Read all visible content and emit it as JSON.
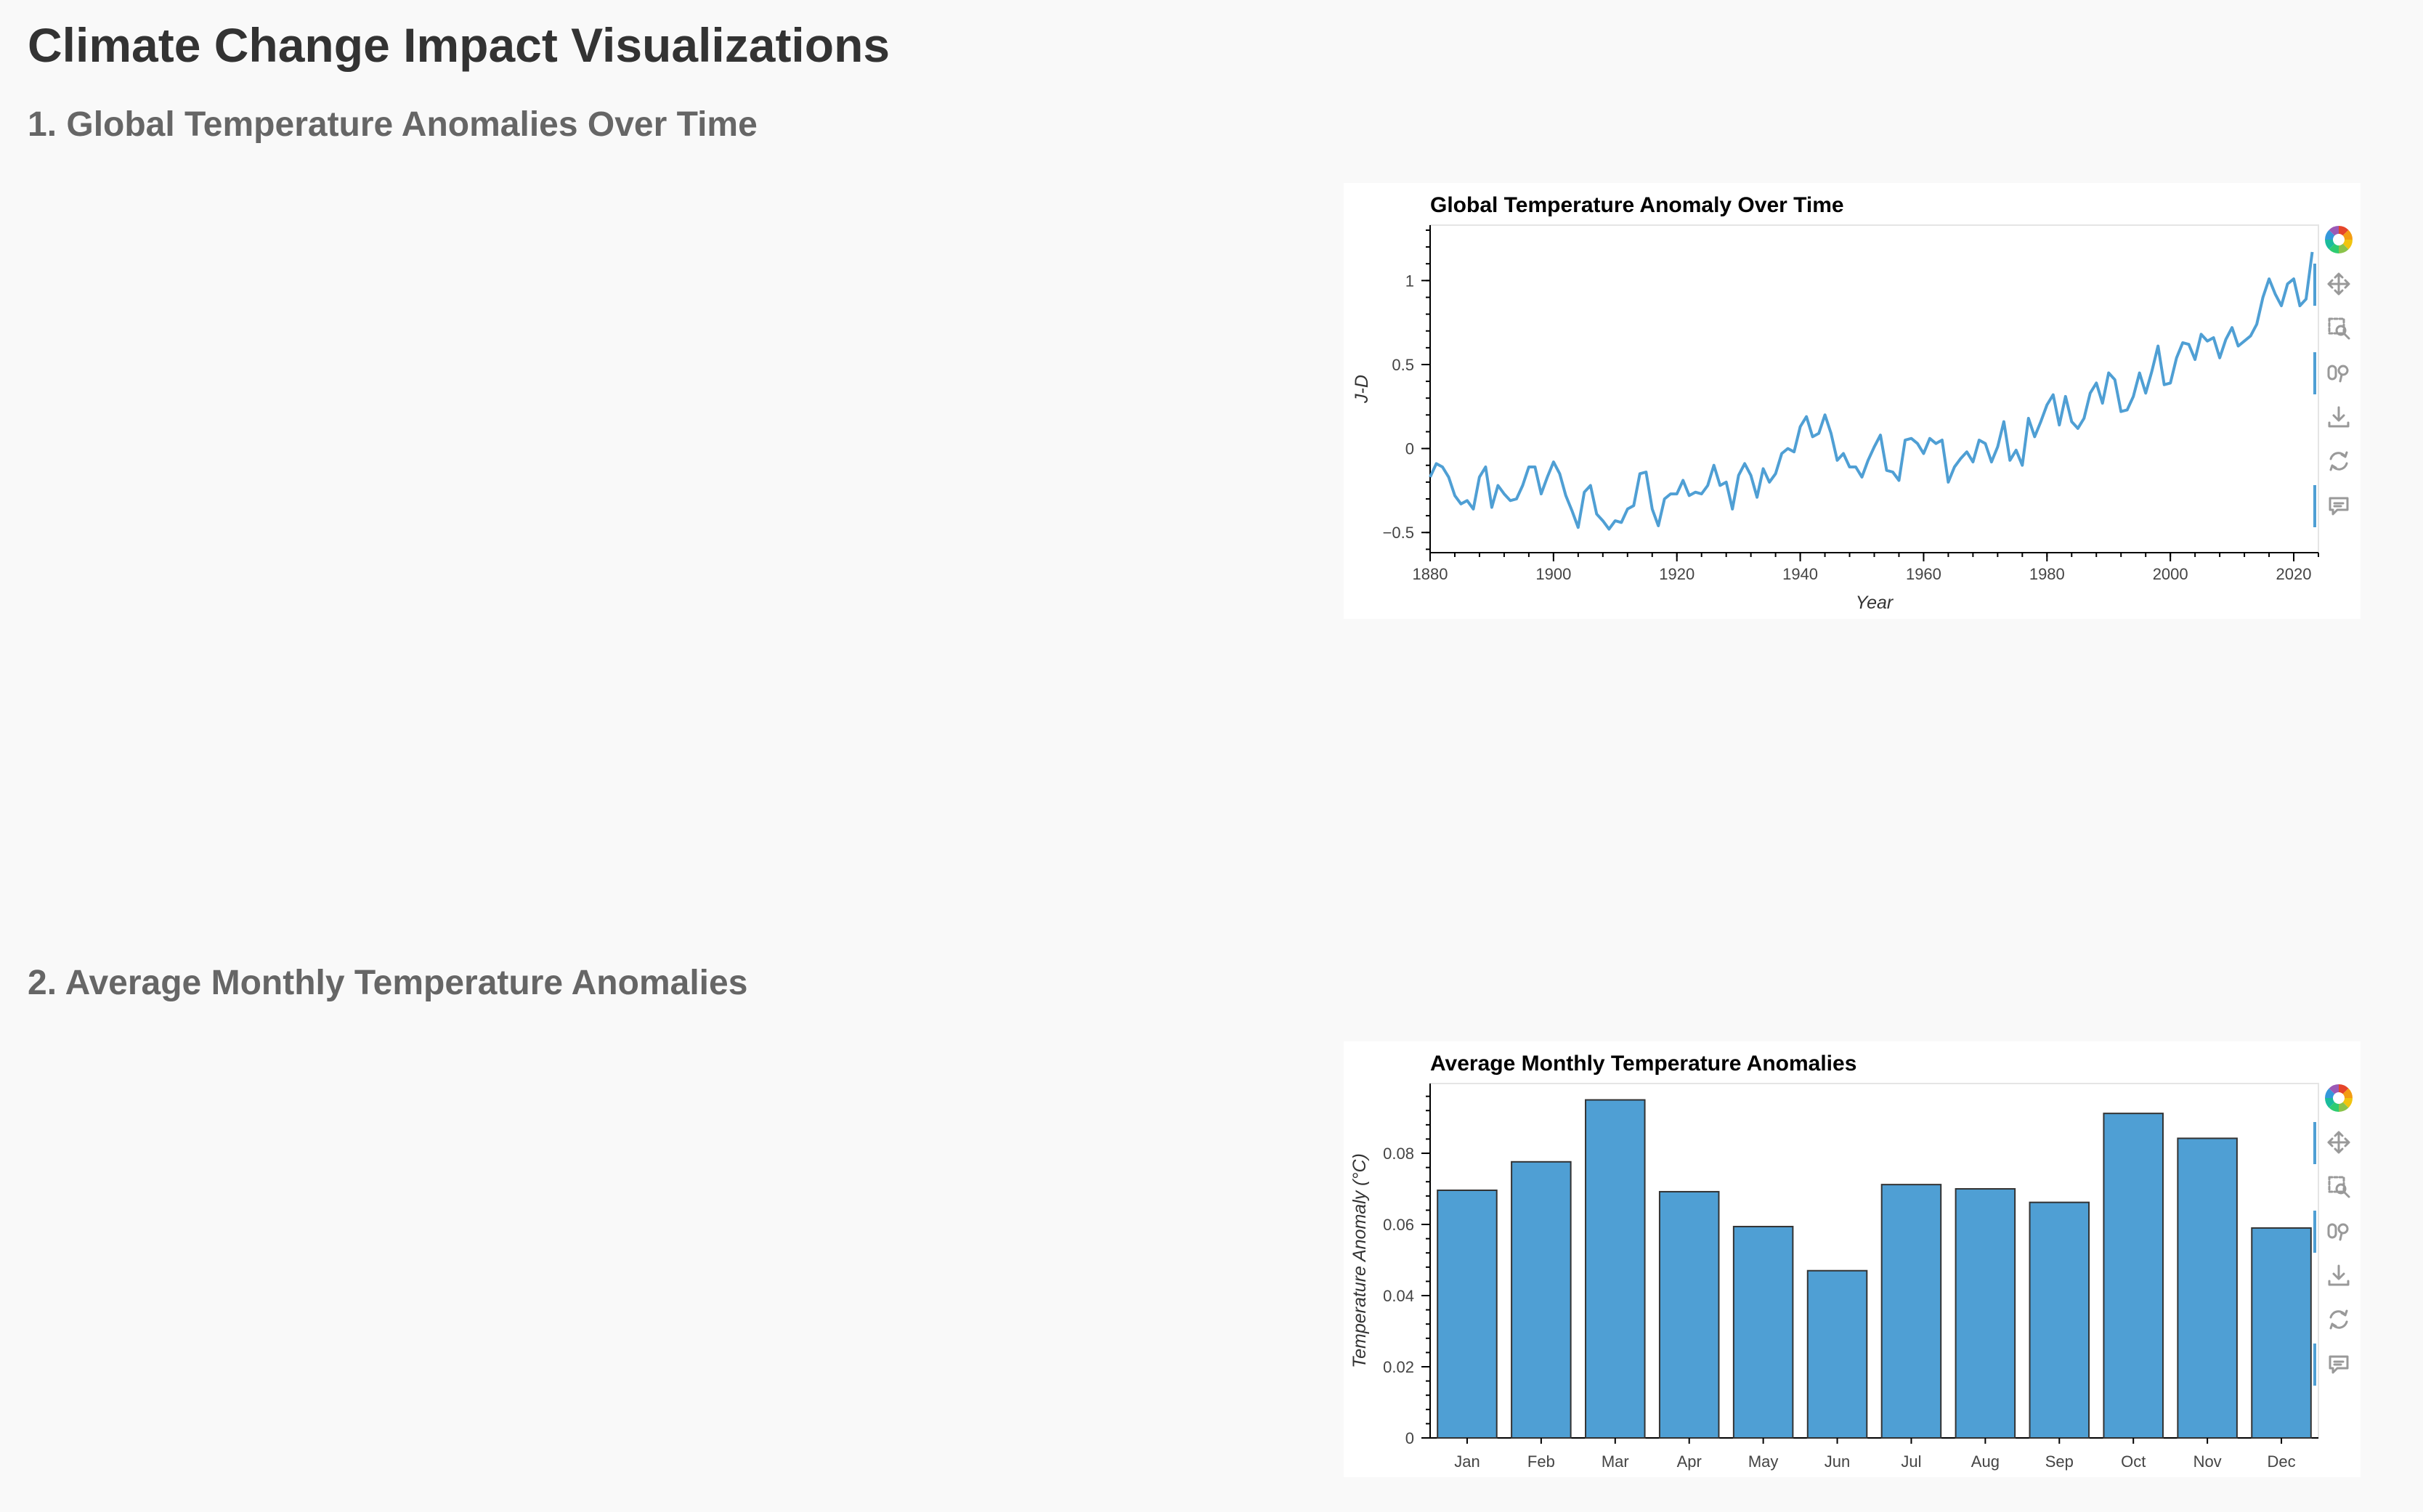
{
  "page": {
    "title": "Climate Change Impact Visualizations",
    "sections": [
      {
        "heading": "1. Global Temperature Anomalies Over Time"
      },
      {
        "heading": "2. Average Monthly Temperature Anomalies"
      }
    ]
  },
  "toolbar": {
    "icons": [
      "bokeh-logo-icon",
      "pan-icon",
      "box-zoom-icon",
      "wheel-zoom-icon",
      "save-icon",
      "reset-icon",
      "hover-icon"
    ],
    "active": [
      "pan-icon",
      "wheel-zoom-icon",
      "hover-icon"
    ]
  },
  "colors": {
    "series": "#4f9fd4",
    "bar_outline": "#333333",
    "heading": "#333333",
    "subheading": "#666666"
  },
  "chart_data": [
    {
      "type": "line",
      "title": "Global Temperature Anomaly Over Time",
      "xlabel": "Year",
      "ylabel": "J-D",
      "xlim": [
        1880,
        2024
      ],
      "ylim": [
        -0.62,
        1.33
      ],
      "xticks": [
        1880,
        1900,
        1920,
        1940,
        1960,
        1980,
        2000,
        2020
      ],
      "yticks": [
        -0.5,
        0,
        0.5,
        1
      ],
      "ytick_labels": [
        "−0.5",
        "0",
        "0.5",
        "1"
      ],
      "grid": false,
      "series": [
        {
          "x": [
            1880,
            1881,
            1882,
            1883,
            1884,
            1885,
            1886,
            1887,
            1888,
            1889,
            1890,
            1891,
            1892,
            1893,
            1894,
            1895,
            1896,
            1897,
            1898,
            1899,
            1900,
            1901,
            1902,
            1903,
            1904,
            1905,
            1906,
            1907,
            1908,
            1909,
            1910,
            1911,
            1912,
            1913,
            1914,
            1915,
            1916,
            1917,
            1918,
            1919,
            1920,
            1921,
            1922,
            1923,
            1924,
            1925,
            1926,
            1927,
            1928,
            1929,
            1930,
            1931,
            1932,
            1933,
            1934,
            1935,
            1936,
            1937,
            1938,
            1939,
            1940,
            1941,
            1942,
            1943,
            1944,
            1945,
            1946,
            1947,
            1948,
            1949,
            1950,
            1951,
            1952,
            1953,
            1954,
            1955,
            1956,
            1957,
            1958,
            1959,
            1960,
            1961,
            1962,
            1963,
            1964,
            1965,
            1966,
            1967,
            1968,
            1969,
            1970,
            1971,
            1972,
            1973,
            1974,
            1975,
            1976,
            1977,
            1978,
            1979,
            1980,
            1981,
            1982,
            1983,
            1984,
            1985,
            1986,
            1987,
            1988,
            1989,
            1990,
            1991,
            1992,
            1993,
            1994,
            1995,
            1996,
            1997,
            1998,
            1999,
            2000,
            2001,
            2002,
            2003,
            2004,
            2005,
            2006,
            2007,
            2008,
            2009,
            2010,
            2011,
            2012,
            2013,
            2014,
            2015,
            2016,
            2017,
            2018,
            2019,
            2020,
            2021,
            2022,
            2023
          ],
          "y": [
            -0.17,
            -0.09,
            -0.11,
            -0.17,
            -0.28,
            -0.33,
            -0.31,
            -0.36,
            -0.17,
            -0.11,
            -0.35,
            -0.22,
            -0.27,
            -0.31,
            -0.3,
            -0.22,
            -0.11,
            -0.11,
            -0.27,
            -0.17,
            -0.08,
            -0.15,
            -0.28,
            -0.37,
            -0.47,
            -0.26,
            -0.22,
            -0.39,
            -0.43,
            -0.48,
            -0.43,
            -0.44,
            -0.36,
            -0.34,
            -0.15,
            -0.14,
            -0.36,
            -0.46,
            -0.3,
            -0.27,
            -0.27,
            -0.19,
            -0.28,
            -0.26,
            -0.27,
            -0.22,
            -0.1,
            -0.22,
            -0.2,
            -0.36,
            -0.16,
            -0.09,
            -0.16,
            -0.29,
            -0.12,
            -0.2,
            -0.15,
            -0.03,
            0.0,
            -0.02,
            0.13,
            0.19,
            0.07,
            0.09,
            0.2,
            0.09,
            -0.07,
            -0.03,
            -0.11,
            -0.11,
            -0.17,
            -0.07,
            0.01,
            0.08,
            -0.13,
            -0.14,
            -0.19,
            0.05,
            0.06,
            0.03,
            -0.03,
            0.06,
            0.03,
            0.05,
            -0.2,
            -0.11,
            -0.06,
            -0.02,
            -0.08,
            0.05,
            0.03,
            -0.08,
            0.01,
            0.16,
            -0.07,
            -0.01,
            -0.1,
            0.18,
            0.07,
            0.16,
            0.26,
            0.32,
            0.14,
            0.31,
            0.16,
            0.12,
            0.18,
            0.33,
            0.39,
            0.27,
            0.45,
            0.41,
            0.22,
            0.23,
            0.31,
            0.45,
            0.33,
            0.46,
            0.61,
            0.38,
            0.39,
            0.54,
            0.63,
            0.62,
            0.53,
            0.68,
            0.64,
            0.66,
            0.54,
            0.65,
            0.72,
            0.61,
            0.64,
            0.67,
            0.74,
            0.9,
            1.01,
            0.92,
            0.85,
            0.98,
            1.01,
            0.85,
            0.89,
            1.17
          ]
        }
      ]
    },
    {
      "type": "bar",
      "title": "Average Monthly Temperature Anomalies",
      "xlabel": "",
      "ylabel": "Temperature Anomaly (°C)",
      "categories": [
        "Jan",
        "Feb",
        "Mar",
        "Apr",
        "May",
        "Jun",
        "Jul",
        "Aug",
        "Sep",
        "Oct",
        "Nov",
        "Dec"
      ],
      "values": [
        0.0696,
        0.0776,
        0.095,
        0.0692,
        0.0594,
        0.047,
        0.0712,
        0.07,
        0.0662,
        0.0912,
        0.0842,
        0.059
      ],
      "ylim": [
        0,
        0.0996
      ],
      "yticks": [
        0,
        0.02,
        0.04,
        0.06,
        0.08
      ],
      "ytick_labels": [
        "0",
        "0.02",
        "0.04",
        "0.06",
        "0.08"
      ],
      "grid": false
    }
  ]
}
